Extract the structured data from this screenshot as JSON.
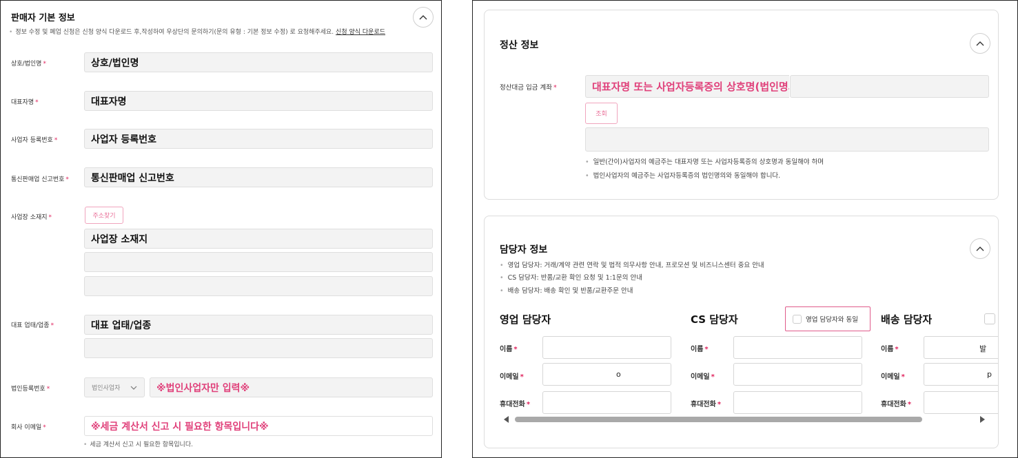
{
  "seller_info": {
    "title": "판매자 기본 정보",
    "notice": "정보 수정 및 폐업 신청은 신청 양식 다운로드 후,작성하여 우상단의 문의하기(문의 유형 : 기본 정보 수정) 로 요청해주세요.",
    "notice_link": "신청 양식 다운로드",
    "required_mark": "*",
    "fields": {
      "company_name": {
        "label": "상호/법인명",
        "value": "상호/법인명"
      },
      "representative": {
        "label": "대표자명",
        "value": "대표자명"
      },
      "business_number": {
        "label": "사업자 등록번호",
        "value": "사업자 등록번호"
      },
      "mail_order_number": {
        "label": "통신판매업 신고번호",
        "value": "통신판매업 신고번호"
      },
      "address": {
        "label": "사업장 소재지",
        "search_button": "주소찾기",
        "value": "사업장 소재지"
      },
      "business_type": {
        "label": "대표 업태/업종",
        "value": "대표 업태/업종"
      },
      "corporate_number": {
        "label": "법인등록번호",
        "select_value": "법인사업자",
        "value": "※법인사업자만 입력※"
      },
      "company_email": {
        "label": "회사 이메일",
        "value": "※세금 계산서 신고 시 필요한 항목입니다※",
        "help": "세금 계산서 신고 시 필요한 항목입니다."
      }
    }
  },
  "settlement": {
    "title": "정산 정보",
    "account_label": "정산대금 입금 계좌",
    "account_value": "대표자명 또는 사업자등록증의 상호명(법인명의)과 동일",
    "lookup_button": "조회",
    "notes": [
      "일반(간이)사업자의 예금주는 대표자명 또는 사업자등록증의 상호명과 동일해야 하며",
      "법인사업자의 예금주는 사업자등록증의 법인명의와 동일해야 합니다."
    ]
  },
  "contacts": {
    "title": "담당자 정보",
    "notes": [
      "영업 담당자: 거래/계약 관련 연락 및 법적 의무사항 안내, 프로모션 및 비즈니스센터 중요 안내",
      "CS 담당자: 반품/교환 확인 요청 및 1:1문의 안내",
      "배송 담당자: 배송 확인 및 반품/교환주문 안내"
    ],
    "sales": {
      "title": "영업 담당자",
      "name_label": "이름",
      "email_label": "이메일",
      "phone_label": "휴대전화",
      "email_value": "o"
    },
    "cs": {
      "title": "CS 담당자",
      "same_as_sales": "영업 담당자와 동일",
      "name_label": "이름",
      "email_label": "이메일",
      "phone_label": "휴대전화"
    },
    "delivery": {
      "title": "배송 담당자",
      "name_label": "이름",
      "email_label": "이메일",
      "phone_label": "휴대전화",
      "name_value": "발",
      "email_value": "p"
    }
  },
  "colors": {
    "accent": "#e0407a",
    "required": "#e0245e",
    "border": "#dcdcdc",
    "field_bg": "#f3f3f3"
  },
  "icons": {
    "collapse": "chevron-up-icon",
    "select_arrow": "chevron-down-icon",
    "scroll_left": "triangle-left-icon",
    "scroll_right": "triangle-right-icon"
  }
}
